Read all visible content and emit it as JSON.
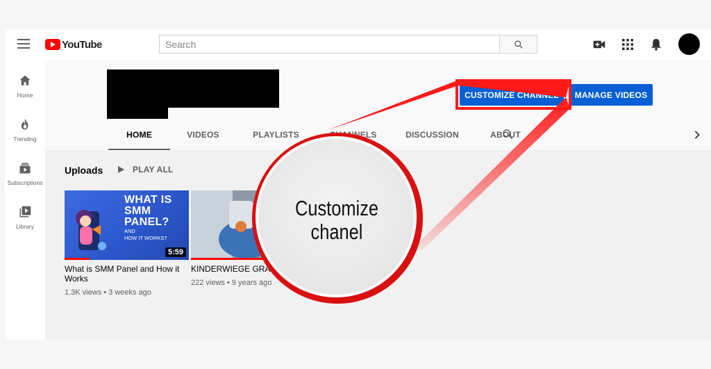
{
  "topbar": {
    "logo_text": "YouTube",
    "search_placeholder": "Search"
  },
  "sidenav": {
    "items": [
      {
        "label": "Home",
        "icon": "home-icon"
      },
      {
        "label": "Trending",
        "icon": "flame-icon"
      },
      {
        "label": "Subscriptions",
        "icon": "subscriptions-icon"
      },
      {
        "label": "Library",
        "icon": "library-icon"
      }
    ]
  },
  "channel": {
    "customize_label": "CUSTOMIZE CHANNEL",
    "manage_label": "MANAGE VIDEOS",
    "tabs": [
      "HOME",
      "VIDEOS",
      "PLAYLISTS",
      "CHANNELS",
      "DISCUSSION",
      "ABOUT"
    ],
    "active_tab": "HOME"
  },
  "uploads": {
    "title": "Uploads",
    "play_all": "PLAY ALL",
    "videos": [
      {
        "thumb_line1": "WHAT IS",
        "thumb_line2": "SMM",
        "thumb_line3": "PANEL?",
        "thumb_sub1": "AND",
        "thumb_sub2": "HOW IT WORKS?",
        "duration": "5:59",
        "title": "What is SMM Panel and How it Works",
        "meta": "1.3K views • 3 weeks ago",
        "watched_fraction": 0.2
      },
      {
        "title": "KINDERWIEGE GRAC",
        "meta": "222 views • 9 years ago",
        "watched_fraction": 0.6
      }
    ]
  },
  "callout": {
    "line1": "Customize",
    "line2": "chanel",
    "color": "#ff1a1a"
  },
  "colors": {
    "brand_red": "#ff0000",
    "button_blue": "#065fd4"
  }
}
